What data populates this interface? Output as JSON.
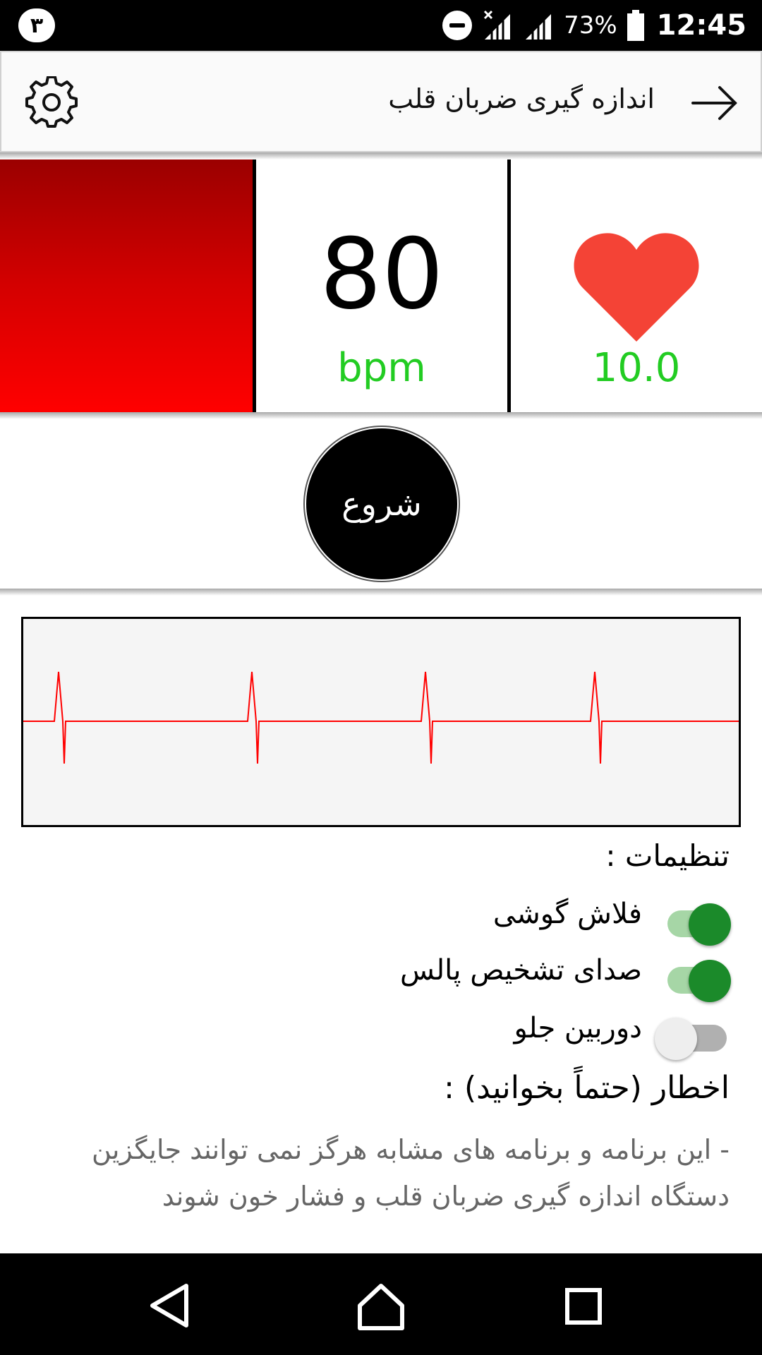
{
  "status_bar": {
    "notification_badge": "٣",
    "battery_percent": "73%",
    "time": "12:45",
    "icons": [
      "do-not-disturb-icon",
      "signal-no-data-icon",
      "signal-icon",
      "battery-icon"
    ]
  },
  "app_bar": {
    "title": "اندازه گیری ضربان قلب",
    "icons": [
      "gear-icon",
      "arrow-right-icon"
    ]
  },
  "metrics": {
    "bpm_value": "80",
    "bpm_unit": "bpm",
    "heart_value": "10.0",
    "camera_preview_color": "#ff0000",
    "value_color": "#22cc22",
    "heart_color": "#f44336"
  },
  "start_button": {
    "label": "شروع"
  },
  "ecg_graph": {
    "line_color": "#ff0000",
    "background": "#f5f5f5"
  },
  "settings": {
    "title": "تنظیمات :",
    "items": [
      {
        "label": "فلاش گوشی",
        "enabled": true
      },
      {
        "label": "صدای تشخیص پالس",
        "enabled": true
      },
      {
        "label": "دوربین جلو",
        "enabled": false
      }
    ]
  },
  "warning": {
    "title": "اخطار (حتماً بخوانید) :",
    "text": "- این برنامه و برنامه های مشابه هرگز نمی توانند جایگزین دستگاه اندازه گیری ضربان قلب و فشار خون شوند"
  },
  "nav_bar": {
    "icons": [
      "back-triangle-icon",
      "home-icon",
      "recents-square-icon"
    ]
  }
}
